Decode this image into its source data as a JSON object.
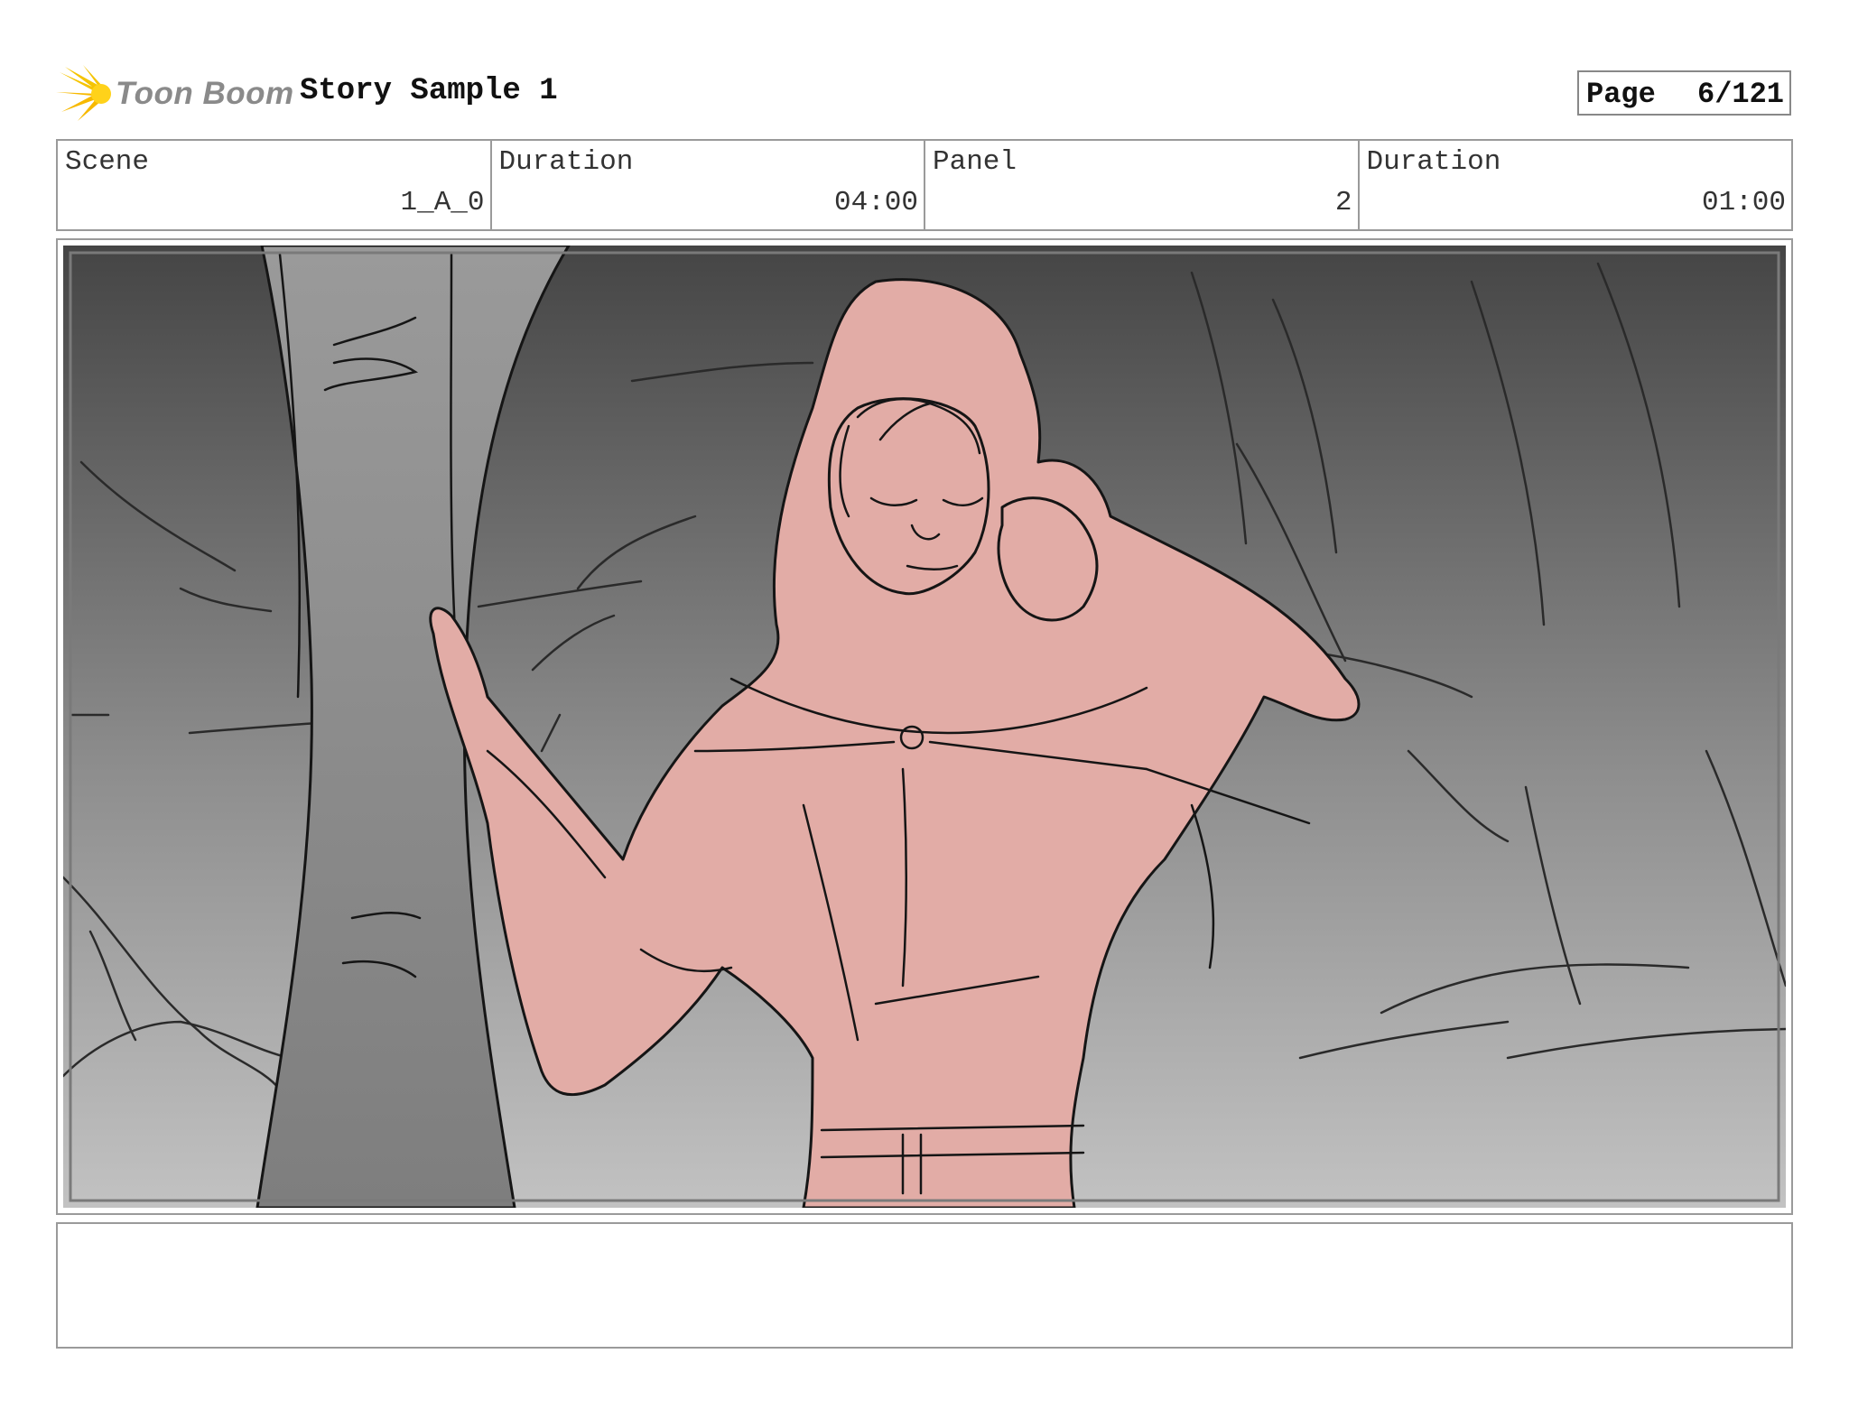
{
  "header": {
    "logo_text": "Toon Boom",
    "project_title": "Story Sample 1",
    "page_label": "Page",
    "page_value": "6/121"
  },
  "info": {
    "scene_label": "Scene",
    "scene_value": "1_A_0",
    "scene_duration_label": "Duration",
    "scene_duration_value": "04:00",
    "panel_label": "Panel",
    "panel_value": "2",
    "panel_duration_label": "Duration",
    "panel_duration_value": "01:00"
  },
  "caption": {
    "text": ""
  },
  "colors": {
    "logo_accent": "#f5c400",
    "frame_border": "#9a9a9a",
    "figure_fill": "#e2aca6",
    "bg_top": "#454545",
    "bg_bottom": "#bdbdbd"
  }
}
